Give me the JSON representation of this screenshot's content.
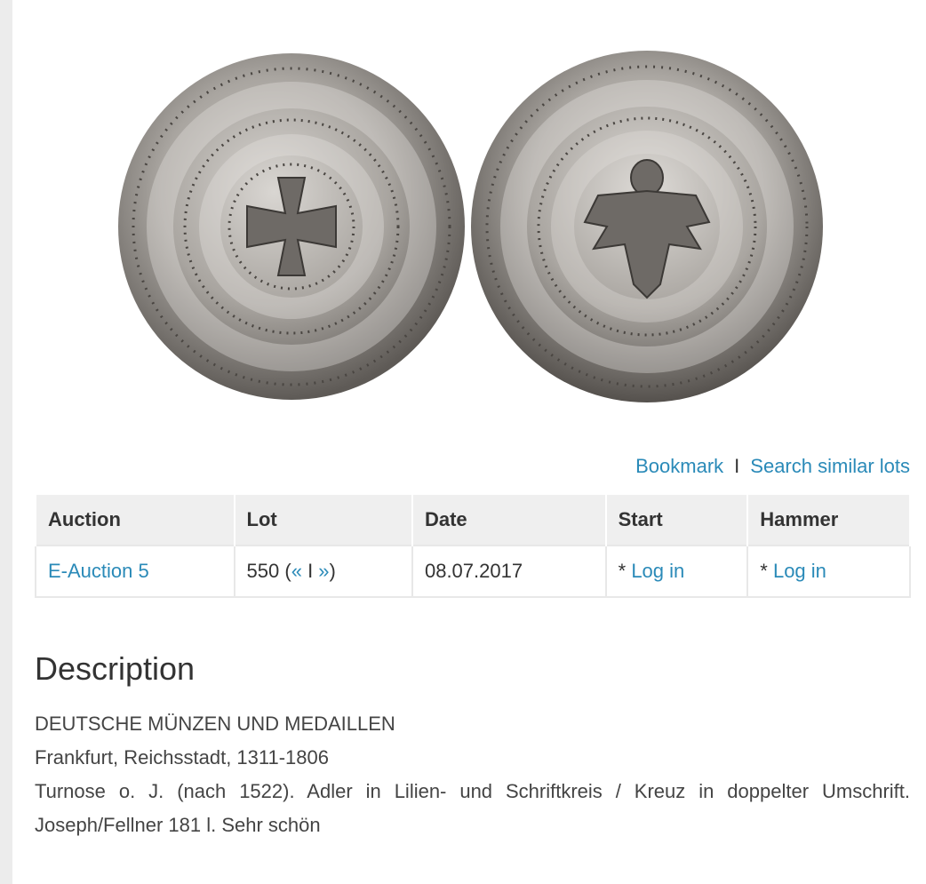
{
  "image": {
    "alt": "Turnose coin obverse and reverse"
  },
  "actions": {
    "bookmark": "Bookmark",
    "separator": "I",
    "search_similar": "Search similar lots"
  },
  "table": {
    "headers": [
      "Auction",
      "Lot",
      "Date",
      "Start",
      "Hammer"
    ],
    "row": {
      "auction": "E-Auction 5",
      "lot_number": "550",
      "lot_open": " (",
      "prev": "«",
      "lot_sep": " I ",
      "next": "»",
      "lot_close": ")",
      "date": "08.07.2017",
      "start_prefix": "* ",
      "start_link": "Log in",
      "hammer_prefix": "* ",
      "hammer_link": "Log in"
    }
  },
  "description": {
    "heading": "Description",
    "line1": "DEUTSCHE MÜNZEN UND MEDAILLEN",
    "line2": "Frankfurt, Reichsstadt, 1311-1806",
    "line3": "Turnose o. J. (nach 1522). Adler in Lilien- und Schriftkreis / Kreuz in doppelter Umschrift. Joseph/Fellner 181 l. Sehr schön"
  },
  "colors": {
    "link": "#2a8ab8",
    "header_bg": "#efefef",
    "rail": "#ececec"
  }
}
